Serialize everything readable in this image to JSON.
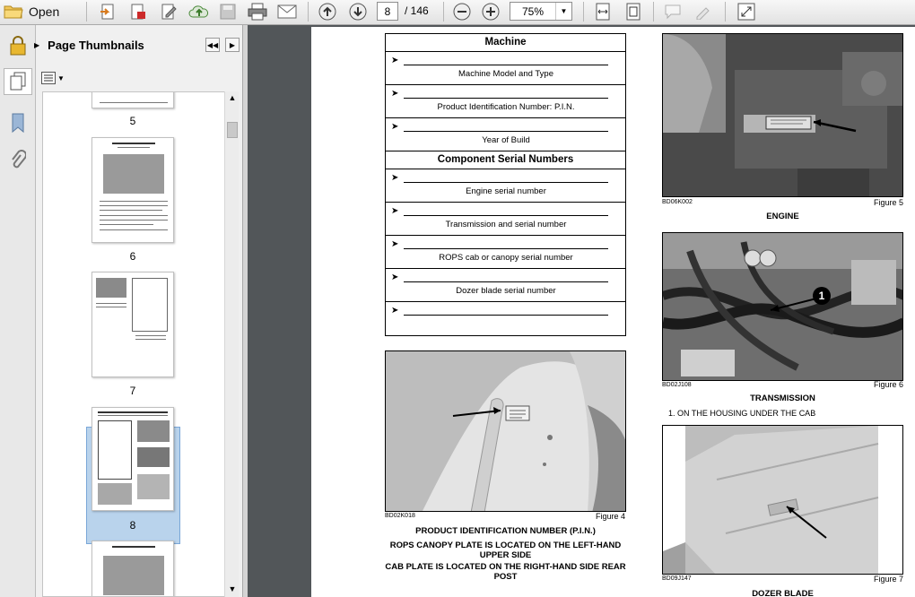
{
  "toolbar": {
    "open_label": "Open",
    "page_current": "8",
    "page_total": "/ 146",
    "zoom": "75%"
  },
  "panel": {
    "title": "Page Thumbnails",
    "thumbnails": [
      "5",
      "6",
      "7",
      "8"
    ]
  },
  "document": {
    "table": {
      "machine_header": "Machine",
      "machine_rows": [
        "Machine Model and Type",
        "Product Identification Number: P.I.N.",
        "Year of Build"
      ],
      "component_header": "Component Serial Numbers",
      "component_rows": [
        "Engine serial number",
        "Transmission and serial number",
        "ROPS cab or canopy serial number",
        "Dozer blade serial number",
        ""
      ]
    },
    "figure4": {
      "code": "BD02K018",
      "number": "Figure 4",
      "title": "PRODUCT IDENTIFICATION NUMBER (P.I.N.)",
      "note1": "ROPS CANOPY PLATE IS LOCATED ON THE LEFT-HAND UPPER SIDE",
      "note2": "CAB PLATE IS LOCATED ON THE RIGHT-HAND SIDE REAR POST"
    },
    "figure5": {
      "code": "BD06K002",
      "number": "Figure 5",
      "title": "ENGINE"
    },
    "figure6": {
      "code": "BD02J108",
      "number": "Figure 6",
      "title": "TRANSMISSION",
      "callout": "1",
      "note": "1. ON THE HOUSING UNDER THE CAB"
    },
    "figure7": {
      "code": "BD09J147",
      "number": "Figure 7",
      "title": "DOZER BLADE"
    }
  }
}
